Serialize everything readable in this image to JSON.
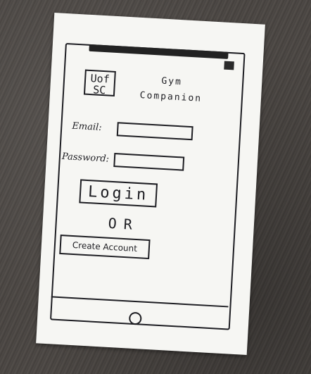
{
  "logo": {
    "line1": "Uof",
    "line2": "SC"
  },
  "app_title": {
    "line1": "Gym",
    "line2": "Companion"
  },
  "login_form": {
    "email_label": "Email:",
    "email_value": "",
    "password_label": "Password:",
    "password_value": "",
    "login_button_label": "Login",
    "or_label": "OR",
    "create_account_label": "Create Account"
  },
  "colors": {
    "ink": "#1d1d22",
    "paper": "#f6f6f3",
    "table": "#4b4743"
  },
  "icons": {
    "home_button": "home-button-icon"
  }
}
